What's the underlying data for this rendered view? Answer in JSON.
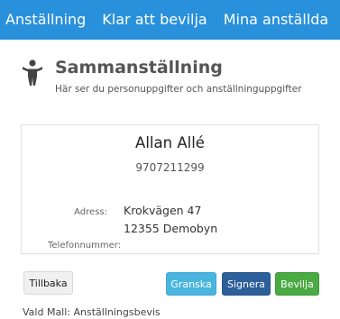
{
  "nav": {
    "items": [
      {
        "label": "Anställning"
      },
      {
        "label": "Klar att bevilja"
      },
      {
        "label": "Mina anställda"
      }
    ]
  },
  "header": {
    "icon": "person-icon",
    "title": "Sammanställning",
    "subtitle": "Här ser du personuppgifter och anställninguppgifter"
  },
  "summary": {
    "name": "Allan Allé",
    "personal_number": "9707211299",
    "address_label": "Adress:",
    "address_line1": "Krokvägen 47",
    "address_line2": "12355 Demobyn",
    "phone_label": "Telefonnummer:"
  },
  "actions": {
    "back_label": "Tillbaka",
    "review_label": "Granska",
    "sign_label": "Signera",
    "approve_label": "Bevilja"
  },
  "footer": {
    "template_text": "Vald Mall: Anställningsbevis"
  },
  "colors": {
    "nav_bg": "#2990db",
    "review": "#4ab6df",
    "sign": "#2d5f9b",
    "approve": "#4aaa44"
  }
}
